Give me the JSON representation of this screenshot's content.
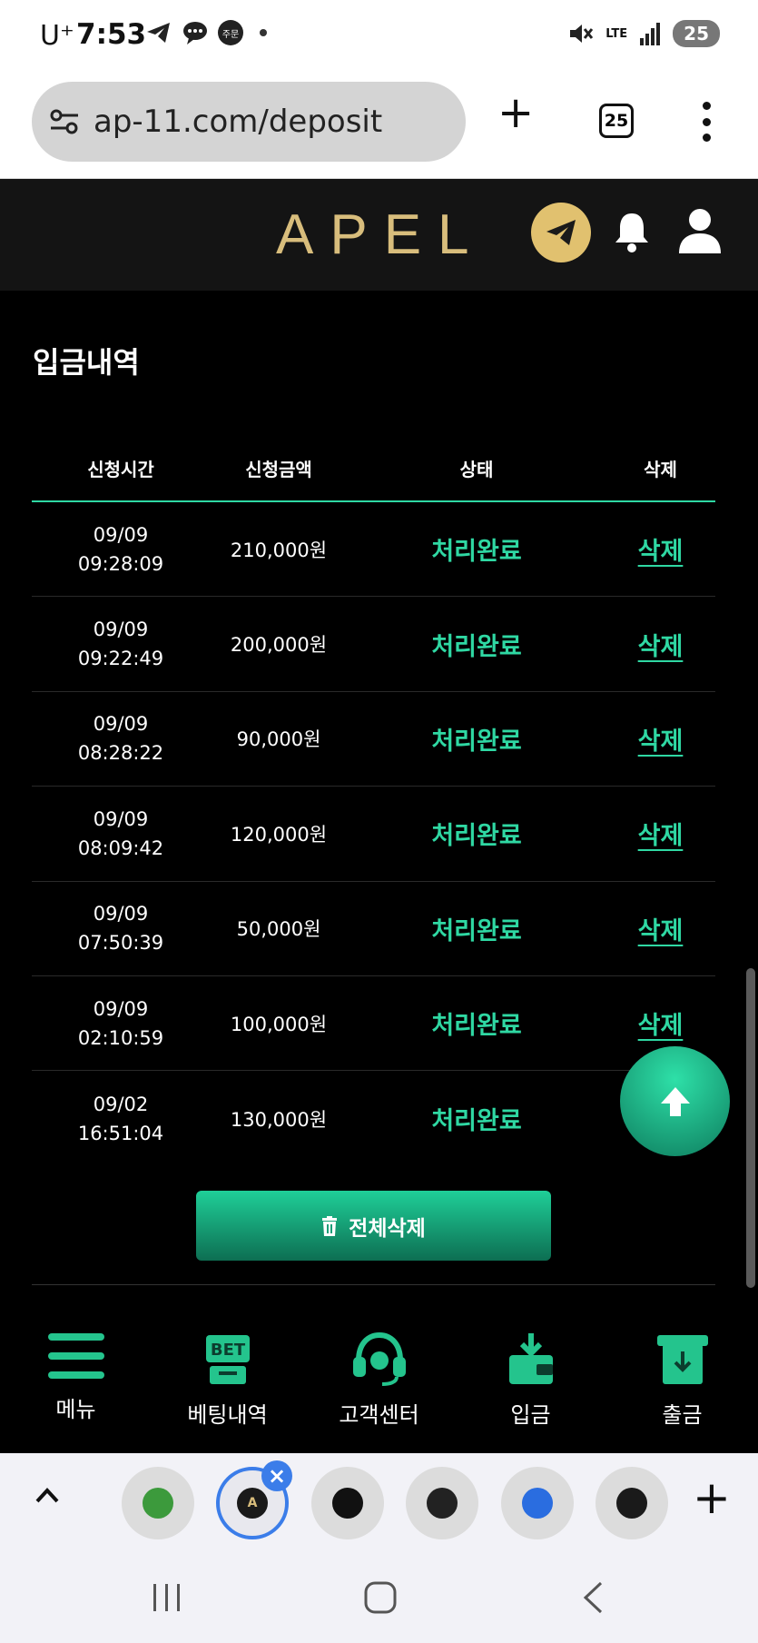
{
  "status_bar": {
    "carrier": "U⁺",
    "time": "7:53",
    "notification_badge": "주문",
    "network": "LTE",
    "battery": "25"
  },
  "browser": {
    "url": "ap-11.com/deposit",
    "tab_count": "25"
  },
  "site": {
    "logo": "APEL"
  },
  "deposit": {
    "title": "입금내역",
    "columns": [
      "신청시간",
      "신청금액",
      "상태",
      "삭제"
    ],
    "rows": [
      {
        "date": "09/09",
        "time": "09:28:09",
        "amount": "210,000원",
        "status": "처리완료",
        "delete": "삭제"
      },
      {
        "date": "09/09",
        "time": "09:22:49",
        "amount": "200,000원",
        "status": "처리완료",
        "delete": "삭제"
      },
      {
        "date": "09/09",
        "time": "08:28:22",
        "amount": "90,000원",
        "status": "처리완료",
        "delete": "삭제"
      },
      {
        "date": "09/09",
        "time": "08:09:42",
        "amount": "120,000원",
        "status": "처리완료",
        "delete": "삭제"
      },
      {
        "date": "09/09",
        "time": "07:50:39",
        "amount": "50,000원",
        "status": "처리완료",
        "delete": "삭제"
      },
      {
        "date": "09/09",
        "time": "02:10:59",
        "amount": "100,000원",
        "status": "처리완료",
        "delete": "삭제"
      },
      {
        "date": "09/02",
        "time": "16:51:04",
        "amount": "130,000원",
        "status": "처리완료",
        "delete": ""
      }
    ],
    "delete_all_label": "전체삭제"
  },
  "bottom_nav": [
    {
      "label": "메뉴",
      "icon": "menu-icon"
    },
    {
      "label": "베팅내역",
      "icon": "bet-icon"
    },
    {
      "label": "고객센터",
      "icon": "headset-icon"
    },
    {
      "label": "입금",
      "icon": "deposit-icon"
    },
    {
      "label": "출금",
      "icon": "withdraw-icon"
    }
  ],
  "colors": {
    "accent": "#2fd8a3",
    "logo_gold": "#d8bd7c",
    "background": "#000000"
  }
}
